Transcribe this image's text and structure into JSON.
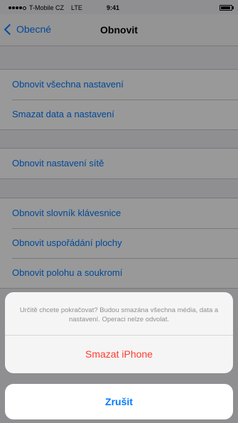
{
  "status_bar": {
    "carrier": "T-Mobile CZ",
    "network": "LTE",
    "time": "9:41",
    "signal_bars": 4
  },
  "nav": {
    "back_label": "Obecné",
    "title": "Obnovit"
  },
  "groups": [
    {
      "rows": [
        "Obnovit všechna nastavení",
        "Smazat data a nastavení"
      ]
    },
    {
      "rows": [
        "Obnovit nastavení sítě"
      ]
    },
    {
      "rows": [
        "Obnovit slovník klávesnice",
        "Obnovit uspořádání plochy",
        "Obnovit polohu a soukromí"
      ]
    }
  ],
  "action_sheet": {
    "message": "Určitě chcete pokračovat? Budou smazána všechna média, data a nastavení. Operaci nelze odvolat.",
    "destructive_label": "Smazat iPhone",
    "cancel_label": "Zrušit"
  },
  "colors": {
    "accent": "#007aff",
    "destructive": "#ff3b30",
    "background": "#efeff4"
  }
}
